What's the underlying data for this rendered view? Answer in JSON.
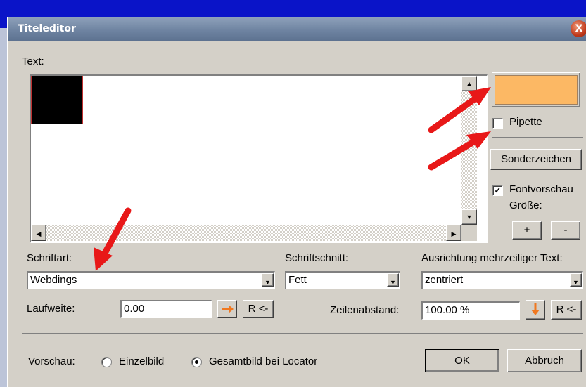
{
  "window": {
    "title": "Titeleditor",
    "close_glyph": "X"
  },
  "text_section": {
    "label": "Text:"
  },
  "color": {
    "swatch": "#fcb864",
    "pipette_label": "Pipette",
    "pipette_checked": false
  },
  "buttons": {
    "special_chars": "Sonderzeichen",
    "size_plus": "+",
    "size_minus": "-",
    "reset_tracking": "R <-",
    "reset_line_spacing": "R <-",
    "ok": "OK",
    "cancel": "Abbruch"
  },
  "font_preview": {
    "label": "Fontvorschau",
    "checked": true,
    "check_glyph": "✓",
    "size_label": "Größe:"
  },
  "font": {
    "family_label": "Schriftart:",
    "family_value": "Webdings",
    "style_label": "Schriftschnitt:",
    "style_value": "Fett",
    "align_label": "Ausrichtung mehrzeiliger Text:",
    "align_value": "zentriert"
  },
  "spacing": {
    "tracking_label": "Laufweite:",
    "tracking_value": "0.00",
    "line_spacing_label": "Zeilenabstand:",
    "line_spacing_value": "100.00 %"
  },
  "preview": {
    "label": "Vorschau:",
    "options": [
      {
        "label": "Einzelbild",
        "selected": false
      },
      {
        "label": "Gesamtbild bei Locator",
        "selected": true
      }
    ]
  },
  "icons": {
    "tracking_direction": "right-arrow-icon",
    "line_spacing_direction": "down-arrow-icon",
    "accent": "#f07820",
    "annotation": "#e81818"
  }
}
